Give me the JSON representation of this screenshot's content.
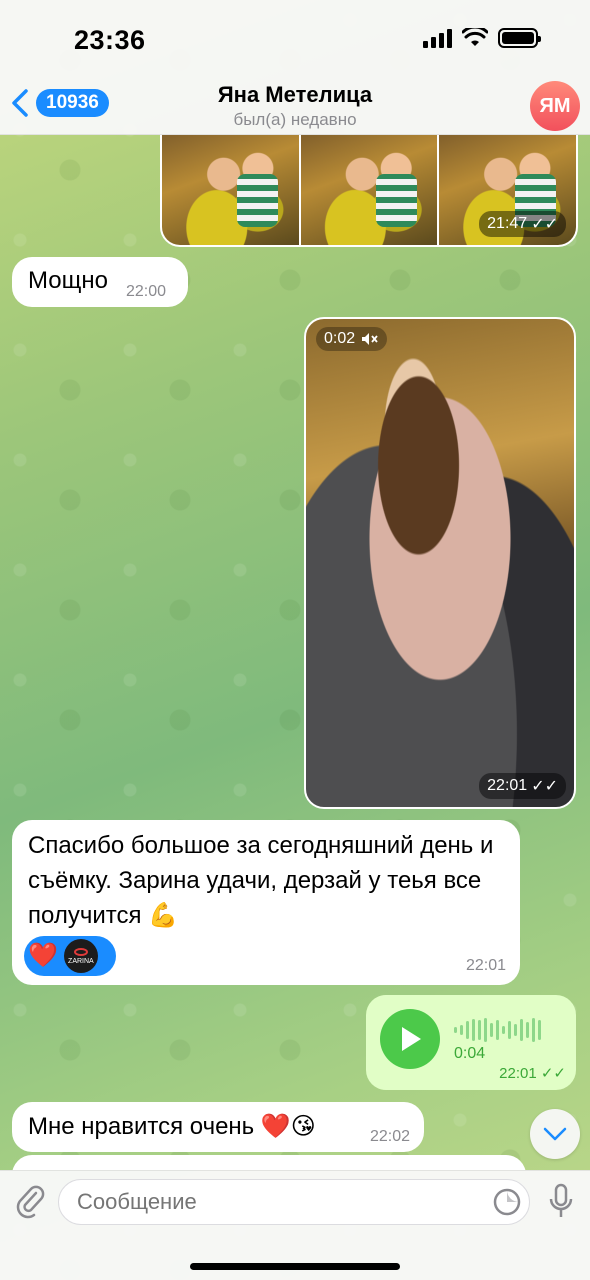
{
  "status_bar": {
    "time": "23:36"
  },
  "header": {
    "back_count": "10936",
    "title": "Яна Метелица",
    "subtitle": "был(а) недавно",
    "avatar_initials": "ЯМ"
  },
  "messages": {
    "photos_time": "21:47",
    "msg1": {
      "text": "Мощно",
      "time": "22:00"
    },
    "video": {
      "duration": "0:02",
      "time": "22:01"
    },
    "msg2": {
      "text": "Спасибо большое за сегодняшний день и съёмку. Зарина удачи, дерзай у теья все получится 💪",
      "time": "22:01",
      "reaction_emoji": "❤️",
      "reaction_avatar_label": "ZARINA"
    },
    "voice": {
      "duration": "0:04",
      "time": "22:01"
    },
    "msg3": {
      "text": "Мне нравится очень ❤️😘",
      "time": "22:02"
    }
  },
  "input": {
    "placeholder": "Сообщение"
  },
  "colors": {
    "accent": "#1a8cff",
    "outgoing_bubble": "#e1fec6",
    "play_green": "#4cc94a"
  },
  "icons": [
    "back-chevron-icon",
    "attach-icon",
    "sticker-icon",
    "mic-icon",
    "mute-icon",
    "read-check-icon",
    "play-icon",
    "chevron-down-icon"
  ]
}
